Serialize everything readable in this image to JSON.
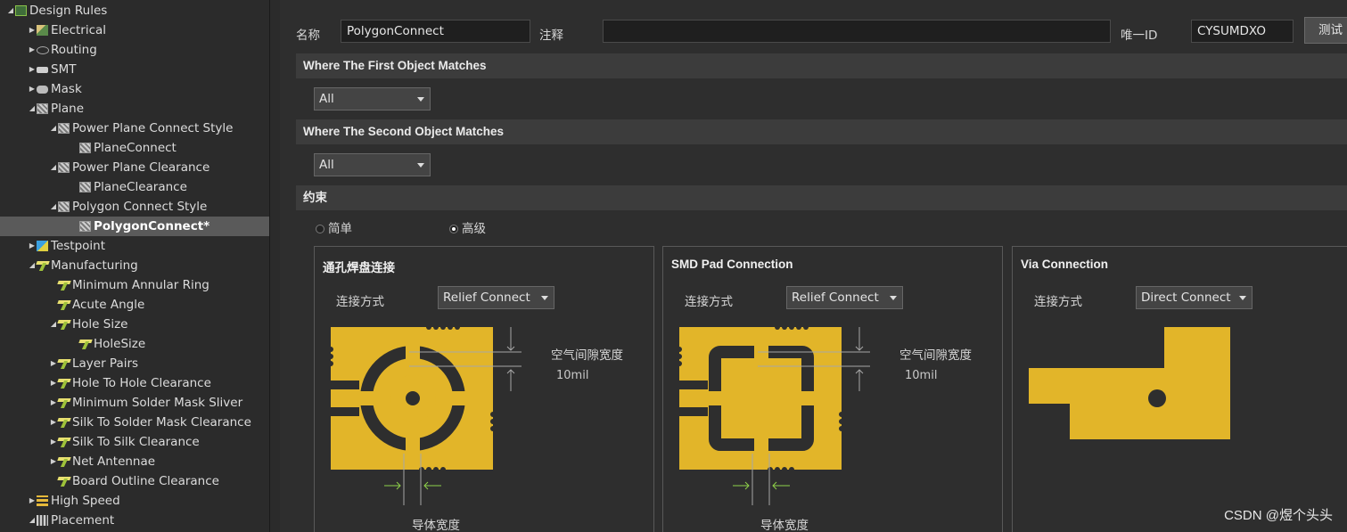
{
  "tree": {
    "items": [
      {
        "label": "Design Rules",
        "icon": "design-rules-icon",
        "toggle": "◢",
        "level": 0
      },
      {
        "label": "Electrical",
        "icon": "electrical-icon",
        "toggle": "▶",
        "level": 1
      },
      {
        "label": "Routing",
        "icon": "routing-icon",
        "toggle": "▶",
        "level": 1
      },
      {
        "label": "SMT",
        "icon": "smt-icon",
        "toggle": "▶",
        "level": 1
      },
      {
        "label": "Mask",
        "icon": "mask-icon",
        "toggle": "▶",
        "level": 1
      },
      {
        "label": "Plane",
        "icon": "plane-icon",
        "toggle": "◢",
        "level": 1
      },
      {
        "label": "Power Plane Connect Style",
        "icon": "plane-rule-icon",
        "toggle": "◢",
        "level": 2
      },
      {
        "label": "PlaneConnect",
        "icon": "plane-rule-icon",
        "toggle": "",
        "level": 3
      },
      {
        "label": "Power Plane Clearance",
        "icon": "plane-rule-icon",
        "toggle": "◢",
        "level": 2
      },
      {
        "label": "PlaneClearance",
        "icon": "plane-rule-icon",
        "toggle": "",
        "level": 3
      },
      {
        "label": "Polygon Connect Style",
        "icon": "plane-rule-icon",
        "toggle": "◢",
        "level": 2
      },
      {
        "label": "PolygonConnect*",
        "icon": "plane-rule-icon",
        "toggle": "",
        "level": 3,
        "selected": true
      },
      {
        "label": "Testpoint",
        "icon": "testpoint-icon",
        "toggle": "▶",
        "level": 1
      },
      {
        "label": "Manufacturing",
        "icon": "manufacturing-icon",
        "toggle": "◢",
        "level": 1
      },
      {
        "label": "Minimum Annular Ring",
        "icon": "rule-icon",
        "toggle": "",
        "level": 2
      },
      {
        "label": "Acute Angle",
        "icon": "rule-icon",
        "toggle": "",
        "level": 2
      },
      {
        "label": "Hole Size",
        "icon": "rule-icon",
        "toggle": "◢",
        "level": 2
      },
      {
        "label": "HoleSize",
        "icon": "rule-icon",
        "toggle": "",
        "level": 3
      },
      {
        "label": "Layer Pairs",
        "icon": "rule-icon",
        "toggle": "▶",
        "level": 2
      },
      {
        "label": "Hole To Hole Clearance",
        "icon": "rule-icon",
        "toggle": "▶",
        "level": 2
      },
      {
        "label": "Minimum Solder Mask Sliver",
        "icon": "rule-icon",
        "toggle": "▶",
        "level": 2
      },
      {
        "label": "Silk To Solder Mask Clearance",
        "icon": "rule-icon",
        "toggle": "▶",
        "level": 2
      },
      {
        "label": "Silk To Silk Clearance",
        "icon": "rule-icon",
        "toggle": "▶",
        "level": 2
      },
      {
        "label": "Net Antennae",
        "icon": "rule-icon",
        "toggle": "▶",
        "level": 2
      },
      {
        "label": "Board Outline Clearance",
        "icon": "rule-icon",
        "toggle": "",
        "level": 2
      },
      {
        "label": "High Speed",
        "icon": "high-speed-icon",
        "toggle": "▶",
        "level": 1
      },
      {
        "label": "Placement",
        "icon": "placement-icon",
        "toggle": "◢",
        "level": 1
      }
    ]
  },
  "header": {
    "name_label": "名称",
    "name_value": "PolygonConnect",
    "comment_label": "注释",
    "comment_value": "",
    "uid_label": "唯一ID",
    "uid_value": "CYSUMDXO",
    "test_button": "测试"
  },
  "first_match": {
    "title": "Where The First Object Matches",
    "value": "All"
  },
  "second_match": {
    "title": "Where The Second Object Matches",
    "value": "All"
  },
  "constraints": {
    "title": "约束",
    "mode_simple": "简单",
    "mode_advanced": "高级",
    "selected_mode": "advanced"
  },
  "cards": [
    {
      "title": "通孔焊盘连接",
      "connect_label": "连接方式",
      "connect_value": "Relief Connect",
      "gap_label": "空气间隙宽度",
      "gap_value": "10mil",
      "width_label": "导体宽度"
    },
    {
      "title": "SMD Pad Connection",
      "connect_label": "连接方式",
      "connect_value": "Relief Connect",
      "gap_label": "空气间隙宽度",
      "gap_value": "10mil",
      "width_label": "导体宽度"
    },
    {
      "title": "Via Connection",
      "connect_label": "连接方式",
      "connect_value": "Direct Connect"
    }
  ],
  "colors": {
    "copper": "#e2b529",
    "background": "#2e2e2e",
    "section": "#3c3c3c",
    "accent_arrow": "#8fd14a"
  },
  "watermark": "CSDN @煜个头头"
}
